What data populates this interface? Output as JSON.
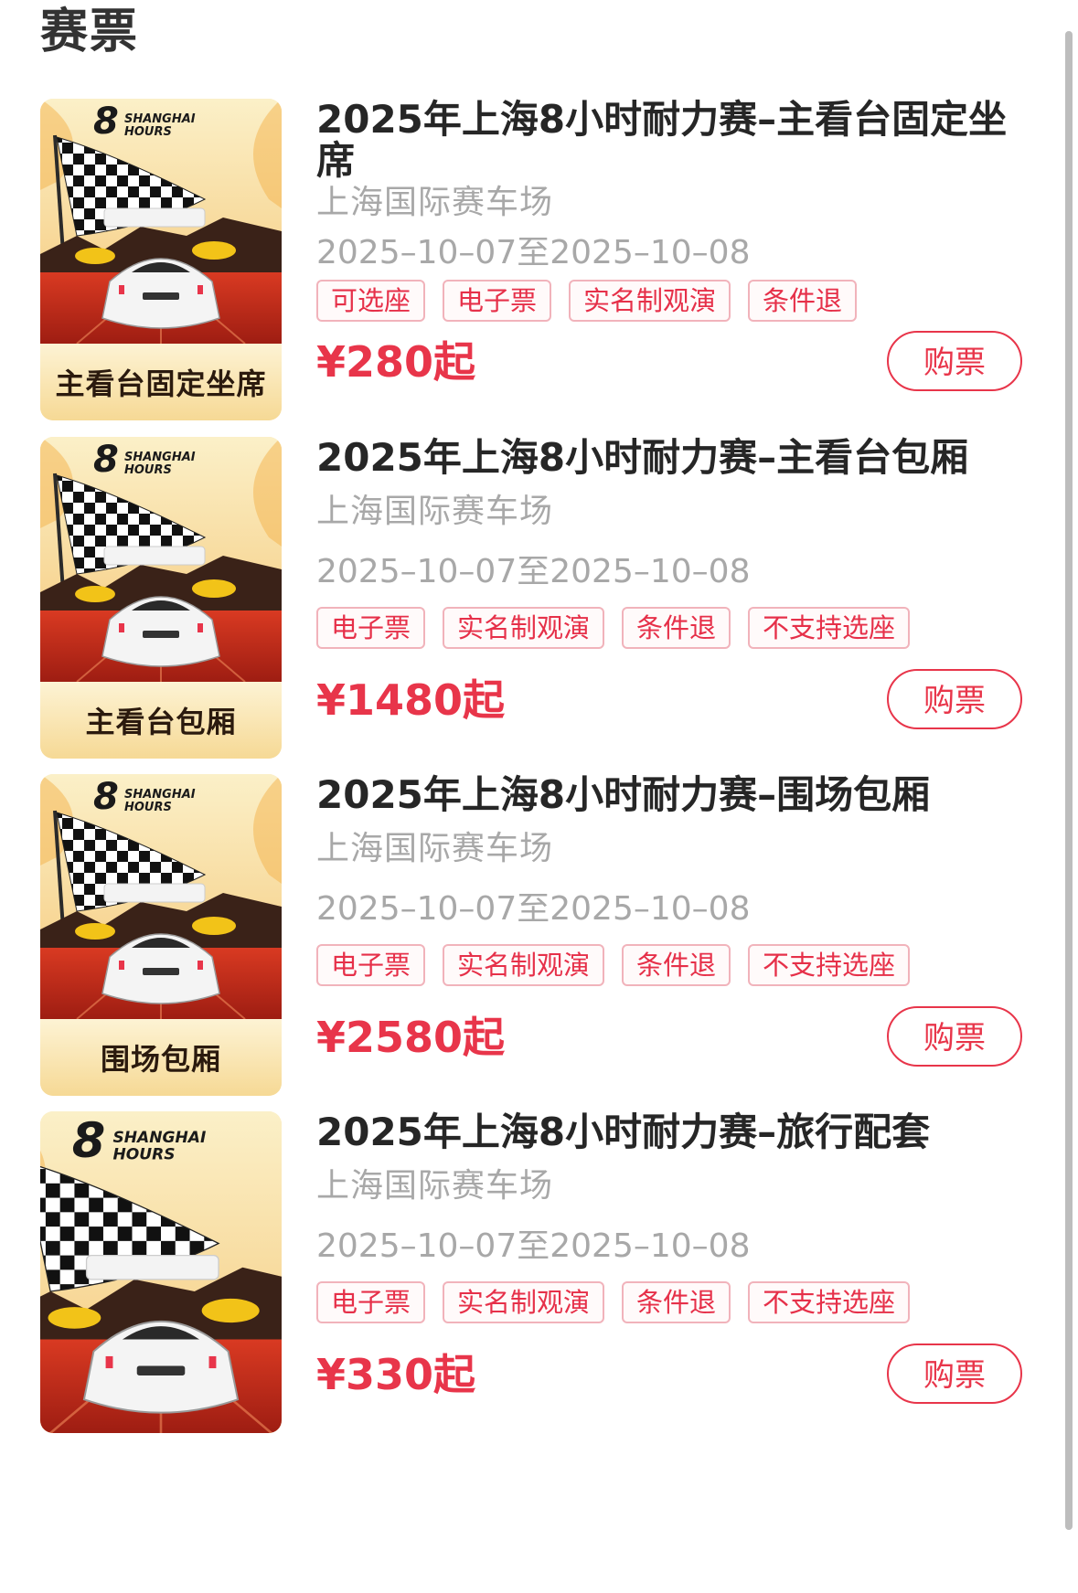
{
  "section": {
    "title": "赛票"
  },
  "colors": {
    "accent": "#e8354a",
    "tag_border": "#f1b3bb",
    "muted_text": "#a8a8a8"
  },
  "tickets": [
    {
      "title": "2025年上海8小时耐力赛–主看台固定坐席",
      "poster_caption": "主看台固定坐席",
      "venue": "上海国际赛车场",
      "dates": "2025–10–07至2025–10–08",
      "tags": [
        "可选座",
        "电子票",
        "实名制观演",
        "条件退"
      ],
      "price": "¥280起",
      "buy_label": "购票"
    },
    {
      "title": "2025年上海8小时耐力赛–主看台包厢",
      "poster_caption": "主看台包厢",
      "venue": "上海国际赛车场",
      "dates": "2025–10–07至2025–10–08",
      "tags": [
        "电子票",
        "实名制观演",
        "条件退",
        "不支持选座"
      ],
      "price": "¥1480起",
      "buy_label": "购票"
    },
    {
      "title": "2025年上海8小时耐力赛–围场包厢",
      "poster_caption": "围场包厢",
      "venue": "上海国际赛车场",
      "dates": "2025–10–07至2025–10–08",
      "tags": [
        "电子票",
        "实名制观演",
        "条件退",
        "不支持选座"
      ],
      "price": "¥2580起",
      "buy_label": "购票"
    },
    {
      "title": "2025年上海8小时耐力赛–旅行配套",
      "poster_caption": "",
      "venue": "上海国际赛车场",
      "dates": "2025–10–07至2025–10–08",
      "tags": [
        "电子票",
        "实名制观演",
        "条件退",
        "不支持选座"
      ],
      "price": "¥330起",
      "buy_label": "购票"
    }
  ]
}
